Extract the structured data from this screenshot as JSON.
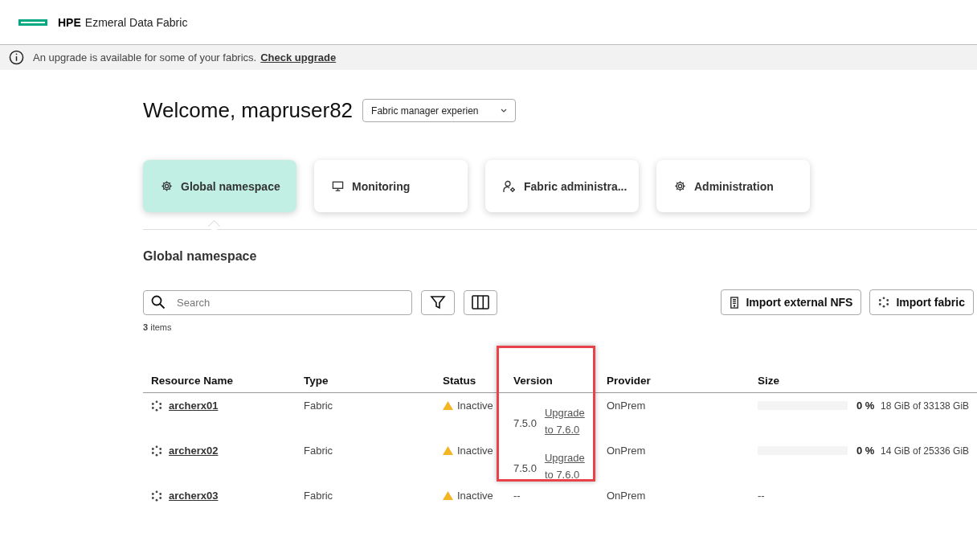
{
  "header": {
    "brand": "HPE",
    "product": "Ezmeral Data Fabric"
  },
  "banner": {
    "message": "An upgrade is available for some of your fabrics.",
    "link": "Check upgrade"
  },
  "welcome": {
    "title": "Welcome, mapruser82",
    "dropdown": "Fabric manager experien"
  },
  "tabs": [
    {
      "label": "Global namespace",
      "selected": true
    },
    {
      "label": "Monitoring",
      "selected": false
    },
    {
      "label": "Fabric administra...",
      "selected": false
    },
    {
      "label": "Administration",
      "selected": false
    }
  ],
  "section": {
    "title": "Global namespace",
    "search_placeholder": "Search",
    "count": "3",
    "count_label": "items",
    "buttons": [
      {
        "label": "Import external NFS"
      },
      {
        "label": "Import fabric"
      }
    ]
  },
  "table": {
    "columns": [
      "Resource Name",
      "Type",
      "Status",
      "Version",
      "Provider",
      "Size"
    ],
    "rows": [
      {
        "name": "archerx01",
        "type": "Fabric",
        "status": "Inactive",
        "version": {
          "number": "7.5.0",
          "upgrade": "Upgrade to 7.6.0"
        },
        "provider": "OnPrem",
        "size": {
          "kind": "usage",
          "level": 0,
          "percent": "0 %",
          "detail": "18 GiB of 33138 GiB"
        }
      },
      {
        "name": "archerx02",
        "type": "Fabric",
        "status": "Inactive",
        "version": {
          "number": "7.5.0",
          "upgrade": "Upgrade to 7.6.0"
        },
        "provider": "OnPrem",
        "size": {
          "kind": "usage",
          "level": 0,
          "percent": "0 %",
          "detail": "14 GiB of 25336 GiB"
        }
      },
      {
        "name": "archerx03",
        "type": "Fabric",
        "status": "Inactive",
        "version": {
          "number": "--"
        },
        "provider": "OnPrem",
        "size": {
          "kind": "empty",
          "text": "--"
        }
      }
    ]
  }
}
